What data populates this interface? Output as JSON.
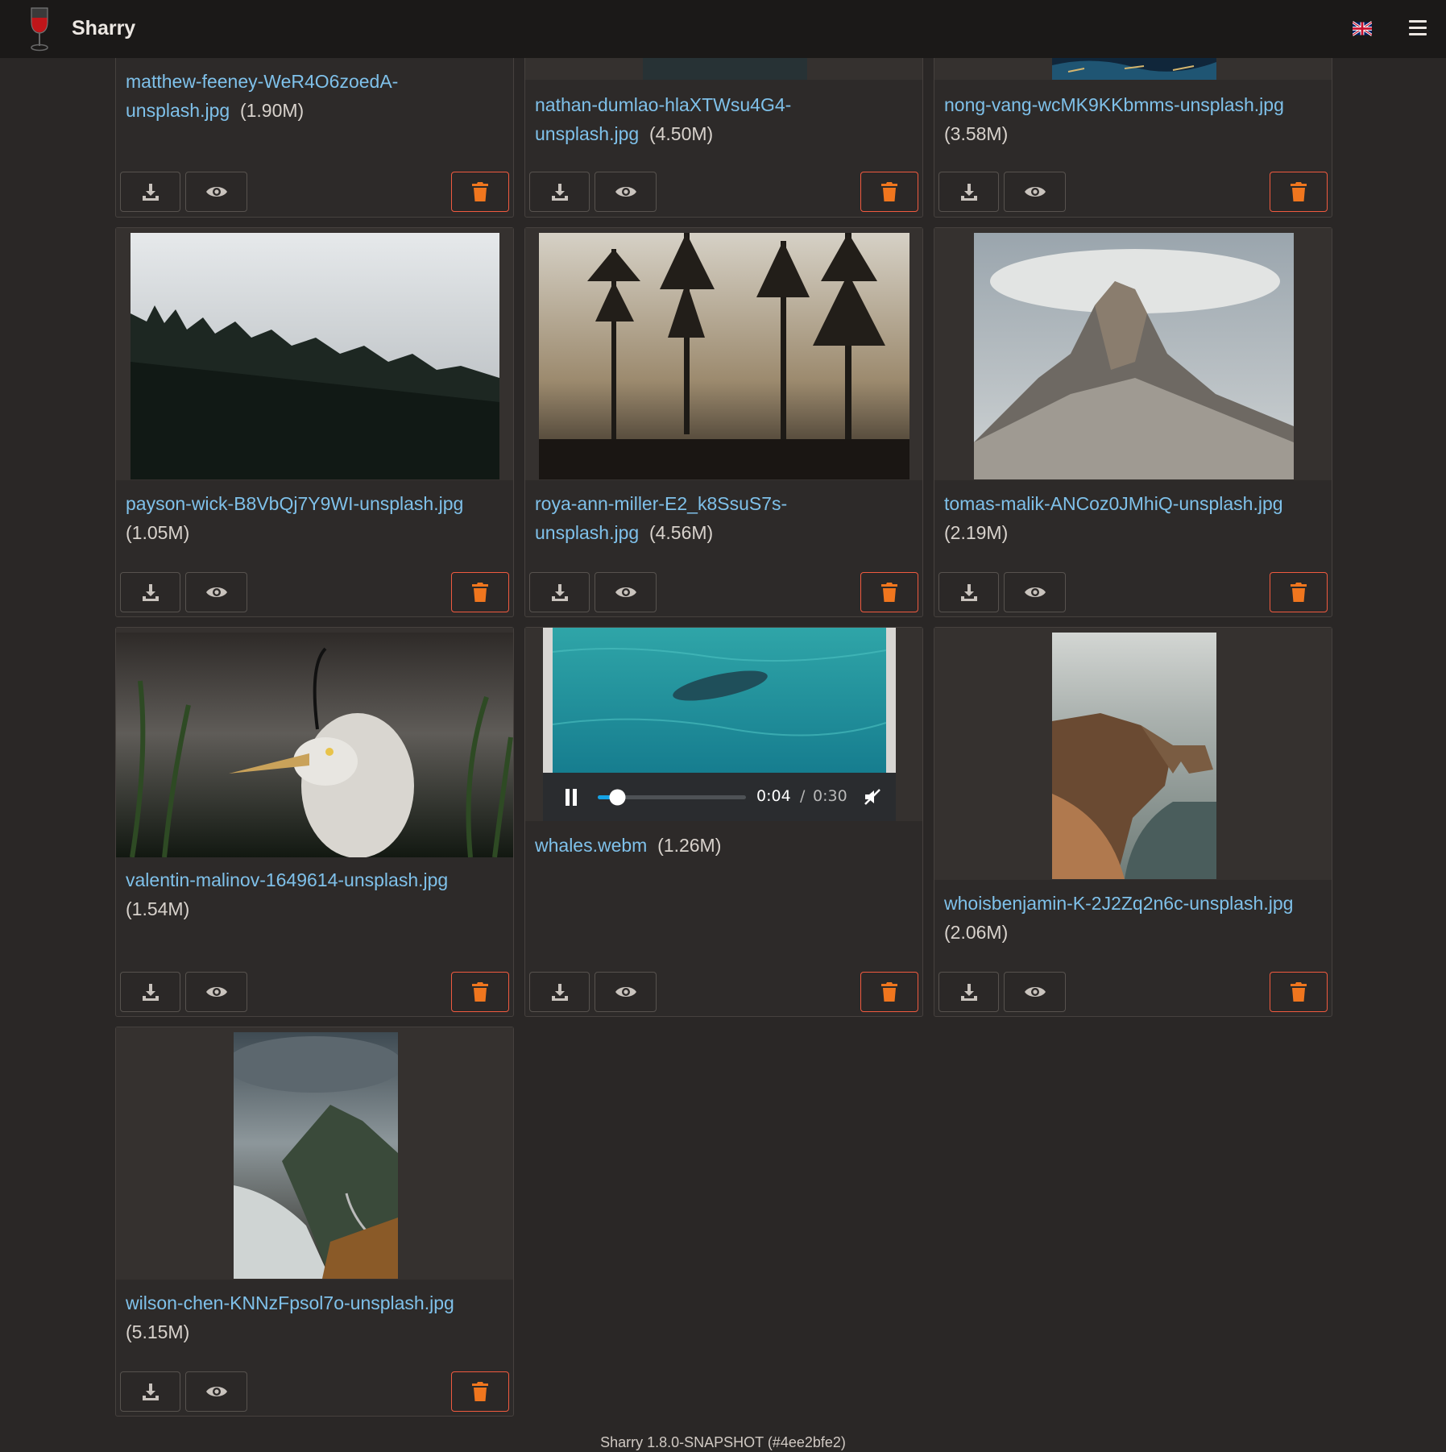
{
  "app": {
    "name": "Sharry"
  },
  "colors": {
    "accent": "#7fc1ea",
    "danger": "#f05a3f",
    "delete_icon": "#f0761e"
  },
  "icons": {
    "logo": "wine-glass-icon",
    "language": "uk-flag-icon",
    "menu": "hamburger-menu-icon",
    "download": "download-icon",
    "view": "eye-icon",
    "delete": "trash-icon",
    "pause": "pause-icon",
    "mute": "muted-speaker-icon"
  },
  "files": [
    {
      "name": "matthew-feeney-WeR4O6zoedA-unsplash.jpg",
      "size": "(1.90M)"
    },
    {
      "name": "nathan-dumlao-hlaXTWsu4G4-unsplash.jpg",
      "size": "(4.50M)"
    },
    {
      "name": "nong-vang-wcMK9KKbmms-unsplash.jpg",
      "size": "(3.58M)"
    },
    {
      "name": "payson-wick-B8VbQj7Y9WI-unsplash.jpg",
      "size": "(1.05M)"
    },
    {
      "name": "roya-ann-miller-E2_k8SsuS7s-unsplash.jpg",
      "size": "(4.56M)"
    },
    {
      "name": "tomas-malik-ANCoz0JMhiQ-unsplash.jpg",
      "size": "(2.19M)"
    },
    {
      "name": "valentin-malinov-1649614-unsplash.jpg",
      "size": "(1.54M)"
    },
    {
      "name": "whales.webm",
      "size": "(1.26M)"
    },
    {
      "name": "whoisbenjamin-K-2J2Zq2n6c-unsplash.jpg",
      "size": "(2.06M)"
    },
    {
      "name": "wilson-chen-KNNzFpsol7o-unsplash.jpg",
      "size": "(5.15M)"
    }
  ],
  "video": {
    "current_time": "0:04",
    "separator": "/",
    "duration": "0:30",
    "progress": 0.133,
    "state": "playing",
    "muted": true
  },
  "footer": {
    "version": "Sharry 1.8.0-SNAPSHOT (#4ee2bfe2)"
  }
}
